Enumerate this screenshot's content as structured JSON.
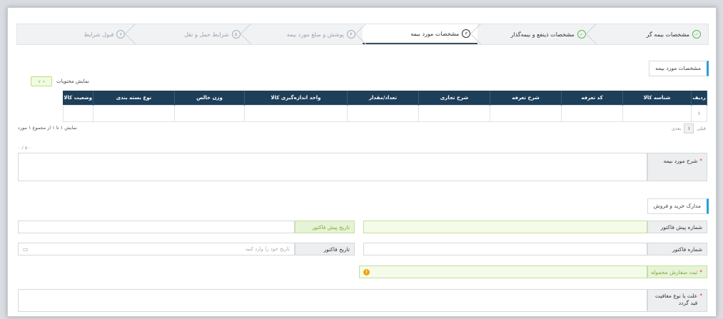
{
  "wizard": {
    "steps": [
      {
        "num": "✓",
        "label": "مشخصات بیمه گر",
        "state": "done"
      },
      {
        "num": "✓",
        "label": "مشخصات ذینفع و بیمه‌گذار",
        "state": "done"
      },
      {
        "num": "۳",
        "label": "مشخصات مورد بیمه",
        "state": "active"
      },
      {
        "num": "۴",
        "label": "پوشش و مبلغ مورد بیمه",
        "state": "pending"
      },
      {
        "num": "۵",
        "label": "شرایط حمل و نقل",
        "state": "pending"
      },
      {
        "num": "۶",
        "label": "قبول شرایط",
        "state": "pending"
      }
    ]
  },
  "section1": {
    "tag": "مشخصات مورد بیمه",
    "toggle_label": "نمایش محتویات",
    "toggle_value": "«  ∨"
  },
  "table": {
    "headers": [
      "ردیف",
      "شناسه کالا",
      "کد تعرفه",
      "شرح تعرفه",
      "شرح تجاری",
      "تعداد/مقدار",
      "واحد اندازه‌گیری کالا",
      "وزن خالص",
      "نوع بسته بندی",
      "وضعیت کالا"
    ],
    "rows": [
      [
        "۱",
        "",
        "",
        "",
        "",
        "",
        "",
        "",
        "",
        ""
      ]
    ],
    "info": "نمایش ۱ تا ۱ از مجموع ۱ مورد",
    "pager": {
      "prev": "قبلی",
      "page": "۱",
      "next": "بعدی"
    }
  },
  "description": {
    "counter": "۵۰۰ / ۰",
    "label": "شرح مورد بیمه",
    "required": "*"
  },
  "section2": {
    "tag": "مدارک خرید و فروش"
  },
  "fields": {
    "proforma_number": "شماره پیش فاکتور",
    "proforma_date": "تاریخ پیش فاکتور",
    "invoice_number": "شماره فاکتور",
    "invoice_date": "تاریخ فاکتور",
    "invoice_date_placeholder": "تاریخ خود را وارد کنید",
    "order_registration": "ثبت سفارش محموله",
    "exemption": "علت یا نوع معافیت قید گردد",
    "required": "*"
  },
  "colors": {
    "header": "#1e3f5a",
    "accent": "#2a9fd8",
    "done": "#5fb84a",
    "warning": "#f2a20c"
  }
}
